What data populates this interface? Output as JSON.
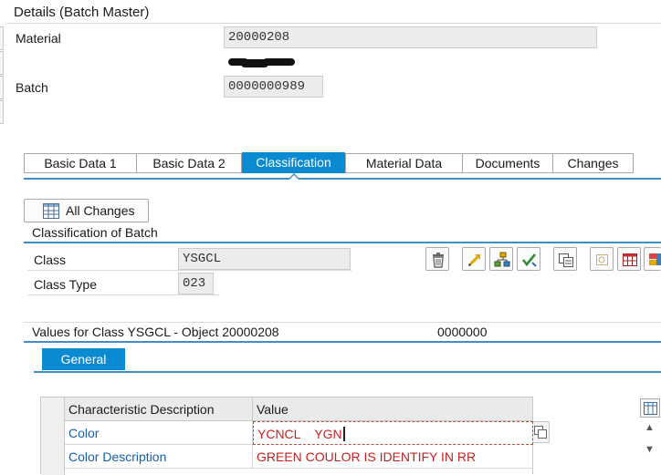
{
  "header": {
    "title": "Details (Batch Master)"
  },
  "fields": {
    "material_label": "Material",
    "material_value": "20000208",
    "batch_label": "Batch",
    "batch_value": "0000000989"
  },
  "tabs": [
    {
      "label": "Basic Data 1",
      "active": false
    },
    {
      "label": "Basic Data 2",
      "active": false
    },
    {
      "label": "Classification",
      "active": true
    },
    {
      "label": "Material Data",
      "active": false
    },
    {
      "label": "Documents",
      "active": false
    },
    {
      "label": "Changes",
      "active": false
    }
  ],
  "toolbar": {
    "all_changes_label": "All Changes",
    "all_changes_icon": "table-icon"
  },
  "classification": {
    "section_title": "Classification of Batch",
    "class_label": "Class",
    "class_value": "YSGCL",
    "class_type_label": "Class Type",
    "class_type_value": "023",
    "icons": [
      "delete-icon",
      "change-arrow-icon",
      "hierarchy-icon",
      "check-icon",
      "copy-icon",
      "find-icon",
      "table-icon",
      "multi-color-icon"
    ]
  },
  "values": {
    "section_title": "Values for Class YSGCL - Object 20000208",
    "extra_value": "0000000",
    "general_tab": "General",
    "table": {
      "headers": [
        "Characteristic Description",
        "Value"
      ],
      "rows": [
        {
          "description": "Color",
          "value": "YCNCL    YGN"
        },
        {
          "description": "Color Description",
          "value": "GREEN COULOR IS IDENTIFY IN RR"
        }
      ]
    }
  },
  "colors": {
    "accent": "#0a8ad0",
    "accent_line": "#3d8fc6",
    "link": "#1560a8",
    "value_text": "#c62020"
  }
}
